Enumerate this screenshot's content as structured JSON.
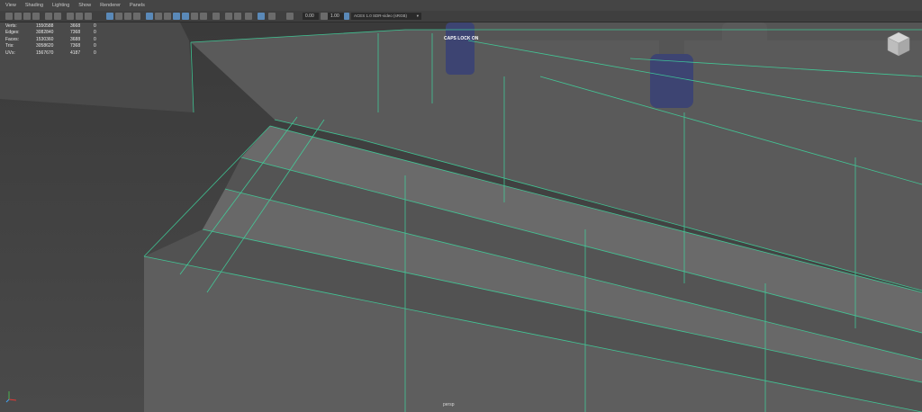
{
  "menu": [
    "View",
    "Shading",
    "Lighting",
    "Show",
    "Renderer",
    "Panels"
  ],
  "toolbar": {
    "exposure": "0.00",
    "gamma": "1.00",
    "color_space": "ACES 1.0 SDR-video (sRGB)"
  },
  "hud": {
    "rows": [
      {
        "label": "Verts:",
        "total": "1550588",
        "selected": "3668",
        "extra": "0"
      },
      {
        "label": "Edges:",
        "total": "3082840",
        "selected": "7368",
        "extra": "0"
      },
      {
        "label": "Faces:",
        "total": "1530360",
        "selected": "3688",
        "extra": "0"
      },
      {
        "label": "Tris:",
        "total": "3058620",
        "selected": "7368",
        "extra": "0"
      },
      {
        "label": "UVs:",
        "total": "1567670",
        "selected": "4187",
        "extra": "0"
      }
    ]
  },
  "caps_lock": "CAPS LOCK ON",
  "camera": "persp",
  "colors": {
    "wire": "#3ed9a0",
    "ground": "#474747",
    "surface": "#5c5c5c",
    "sky": "#3c3c3c"
  }
}
